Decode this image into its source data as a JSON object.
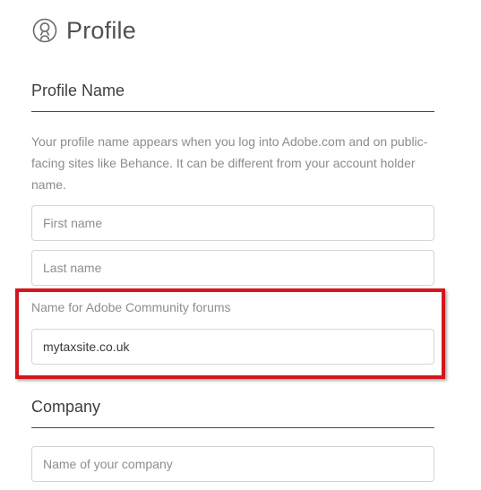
{
  "header": {
    "title": "Profile",
    "icon": "user-circle-icon"
  },
  "profile_name_section": {
    "heading": "Profile Name",
    "description": "Your profile name appears when you log into Adobe.com and on public-facing sites like Behance. It can be different from your account holder name.",
    "first_name": {
      "placeholder": "First name",
      "value": ""
    },
    "last_name": {
      "placeholder": "Last name",
      "value": ""
    },
    "community_name": {
      "label": "Name for Adobe Community forums",
      "value": "mytaxsite.co.uk"
    }
  },
  "company_section": {
    "heading": "Company",
    "company_name": {
      "placeholder": "Name of your company",
      "value": ""
    }
  },
  "annotation": {
    "highlight_color": "#d4161c"
  }
}
